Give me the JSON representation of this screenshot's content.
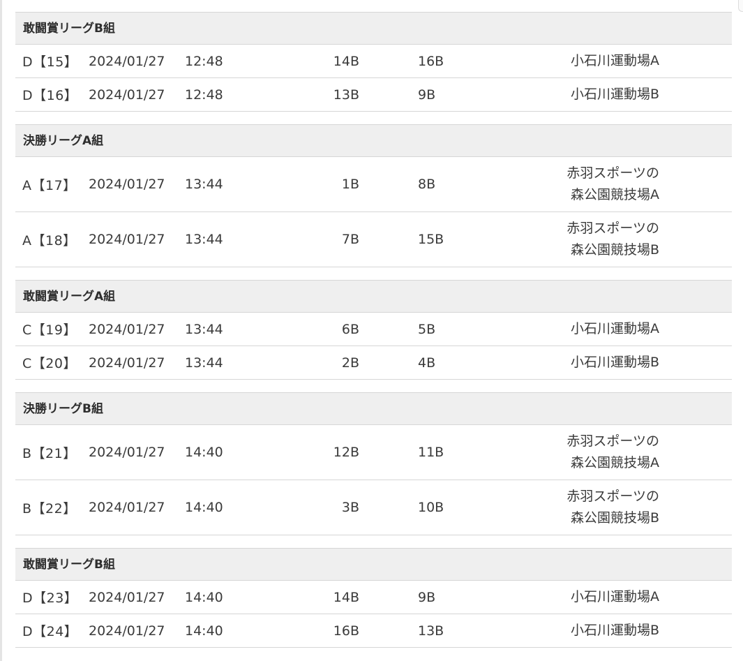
{
  "groups": [
    {
      "title": "敢闘賞リーグB組",
      "matches": [
        {
          "id": "D【15】",
          "date": "2024/01/27",
          "time": "12:48",
          "home": "14B",
          "away": "16B",
          "venue": "小石川運動場A"
        },
        {
          "id": "D【16】",
          "date": "2024/01/27",
          "time": "12:48",
          "home": "13B",
          "away": "9B",
          "venue": "小石川運動場B"
        }
      ]
    },
    {
      "title": "決勝リーグA組",
      "matches": [
        {
          "id": "A【17】",
          "date": "2024/01/27",
          "time": "13:44",
          "home": "1B",
          "away": "8B",
          "venue": "赤羽スポーツの\n森公園競技場A"
        },
        {
          "id": "A【18】",
          "date": "2024/01/27",
          "time": "13:44",
          "home": "7B",
          "away": "15B",
          "venue": "赤羽スポーツの\n森公園競技場B"
        }
      ]
    },
    {
      "title": "敢闘賞リーグA組",
      "matches": [
        {
          "id": "C【19】",
          "date": "2024/01/27",
          "time": "13:44",
          "home": "6B",
          "away": "5B",
          "venue": "小石川運動場A"
        },
        {
          "id": "C【20】",
          "date": "2024/01/27",
          "time": "13:44",
          "home": "2B",
          "away": "4B",
          "venue": "小石川運動場B"
        }
      ]
    },
    {
      "title": "決勝リーグB組",
      "matches": [
        {
          "id": "B【21】",
          "date": "2024/01/27",
          "time": "14:40",
          "home": "12B",
          "away": "11B",
          "venue": "赤羽スポーツの\n森公園競技場A"
        },
        {
          "id": "B【22】",
          "date": "2024/01/27",
          "time": "14:40",
          "home": "3B",
          "away": "10B",
          "venue": "赤羽スポーツの\n森公園競技場B"
        }
      ]
    },
    {
      "title": "敢闘賞リーグB組",
      "matches": [
        {
          "id": "D【23】",
          "date": "2024/01/27",
          "time": "14:40",
          "home": "14B",
          "away": "9B",
          "venue": "小石川運動場A"
        },
        {
          "id": "D【24】",
          "date": "2024/01/27",
          "time": "14:40",
          "home": "16B",
          "away": "13B",
          "venue": "小石川運動場B"
        }
      ]
    }
  ]
}
